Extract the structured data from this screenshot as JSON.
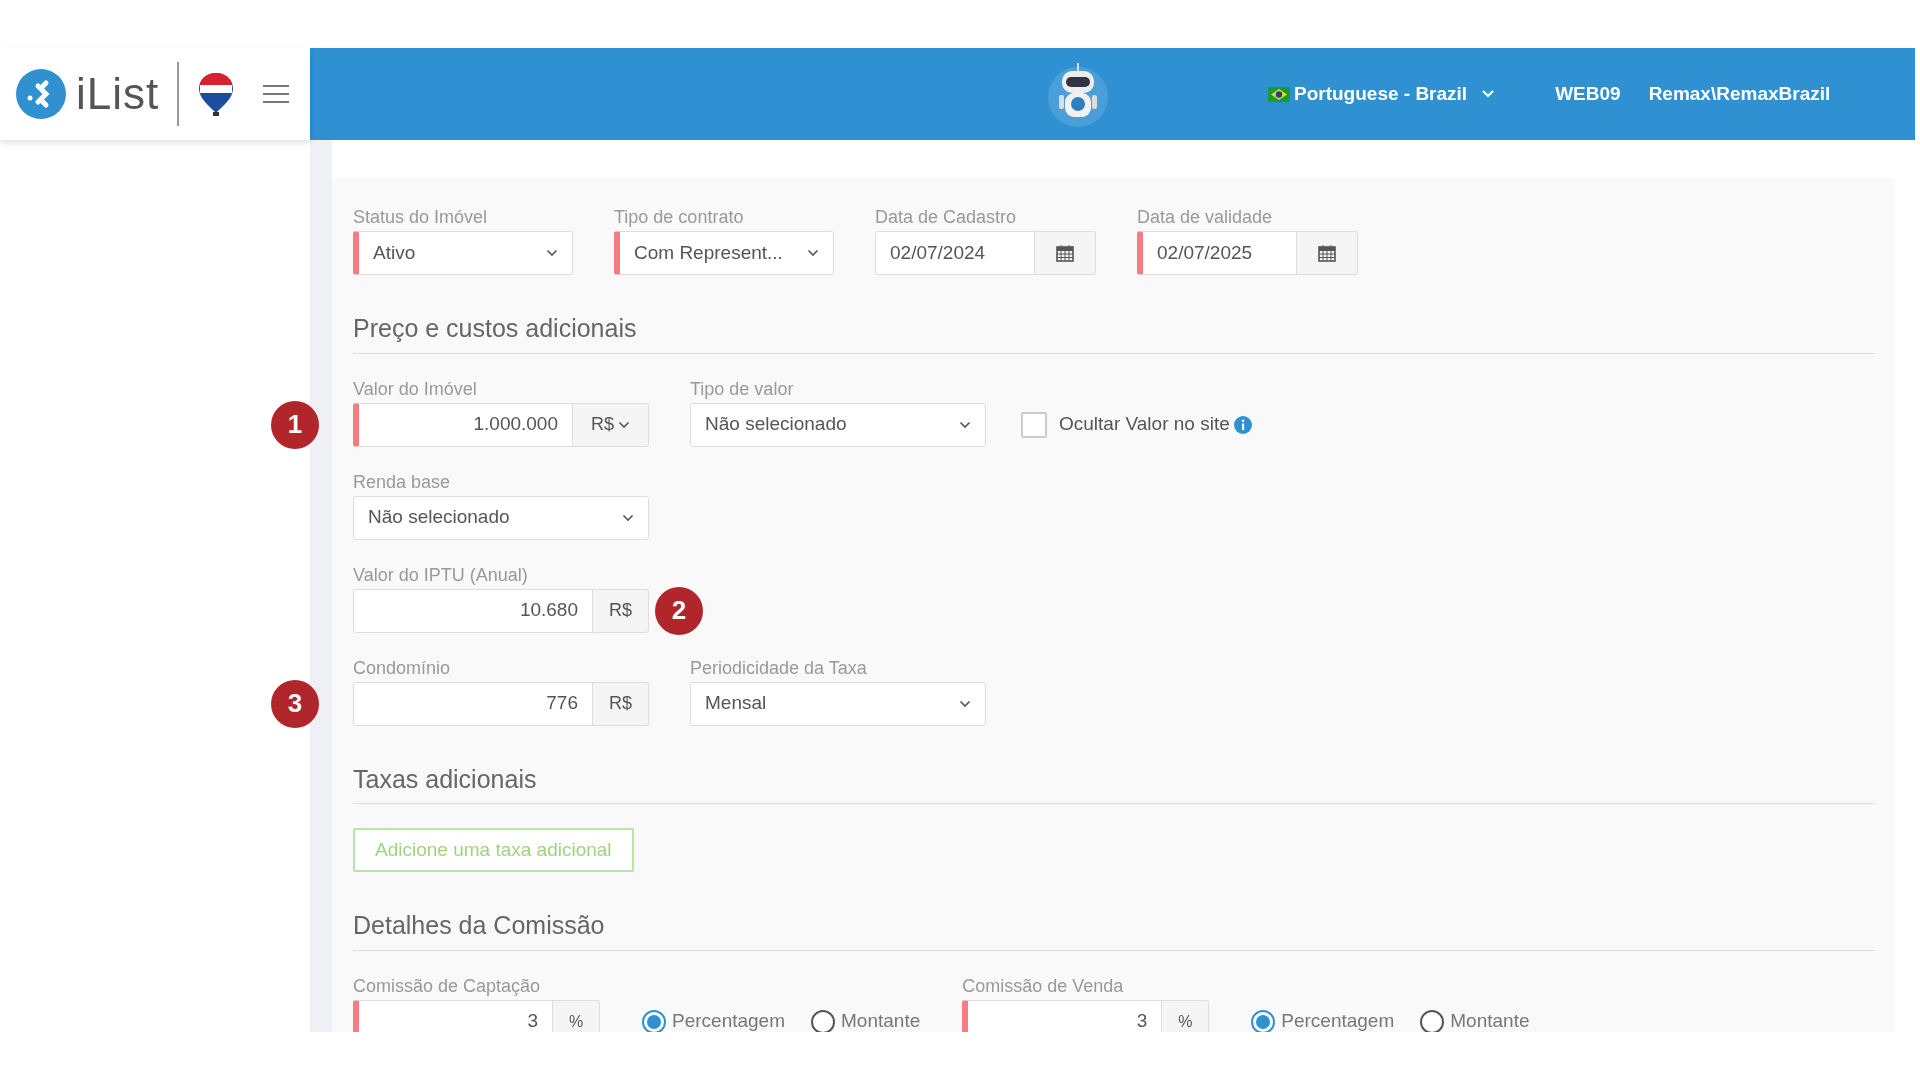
{
  "header": {
    "brand": "iList",
    "language": "Portuguese - Brazil",
    "office": "WEB09",
    "user": "Remax\\RemaxBrazil"
  },
  "sections": [
    {
      "rows": [
        [
          {
            "kind": "select",
            "label": "Status do Imóvel",
            "value": "Ativo",
            "required": true
          },
          {
            "kind": "select",
            "label": "Tipo de contrato",
            "value": "Com Represent...",
            "required": true
          },
          {
            "kind": "date",
            "label": "Data de Cadastro",
            "value": "02/07/2024",
            "required": false
          },
          {
            "kind": "date",
            "label": "Data de validade",
            "value": "02/07/2025",
            "required": true
          }
        ]
      ]
    },
    {
      "title": "Preço e custos adicionais",
      "rows": [
        [
          {
            "kind": "marker",
            "number": "1"
          },
          {
            "kind": "amount",
            "label": "Valor do Imóvel",
            "value": "1.000.000",
            "addon": "R$",
            "addon_dropdown": true,
            "required": true
          },
          {
            "kind": "select",
            "label": "Tipo de valor",
            "value": "Não selecionado",
            "required": false
          },
          {
            "kind": "checkbox",
            "label": "Ocultar Valor no site",
            "checked": false
          }
        ],
        [
          {
            "kind": "select",
            "label": "Renda base",
            "value": "Não selecionado",
            "required": false
          }
        ],
        [
          {
            "kind": "amount",
            "label": "Valor do IPTU (Anual)",
            "value": "10.680",
            "addon": "R$",
            "addon_dropdown": false,
            "required": false
          },
          {
            "kind": "marker",
            "number": "2"
          }
        ],
        [
          {
            "kind": "marker",
            "number": "3"
          },
          {
            "kind": "amount",
            "label": "Condomínio",
            "value": "776",
            "addon": "R$",
            "addon_dropdown": false,
            "required": false
          },
          {
            "kind": "select",
            "label": "Periodicidade da Taxa",
            "value": "Mensal",
            "required": false
          }
        ]
      ]
    },
    {
      "title": "Taxas adicionais",
      "rows": [
        [
          {
            "kind": "button",
            "label": "Adicione uma taxa adicional"
          }
        ]
      ]
    },
    {
      "title": "Detalhes da Comissão",
      "rows": [
        [
          {
            "kind": "amount",
            "label": "Comissão de Captação",
            "value": "3",
            "addon": "%",
            "addon_dropdown": false,
            "required": true
          },
          {
            "kind": "radios",
            "options": [
              {
                "label": "Percentagem",
                "selected": true
              },
              {
                "label": "Montante",
                "selected": false
              }
            ]
          },
          {
            "kind": "amount",
            "label": "Comissão de Venda",
            "value": "3",
            "addon": "%",
            "addon_dropdown": false,
            "required": true
          },
          {
            "kind": "radios",
            "options": [
              {
                "label": "Percentagem",
                "selected": true
              },
              {
                "label": "Montante",
                "selected": false
              }
            ]
          }
        ]
      ]
    }
  ]
}
